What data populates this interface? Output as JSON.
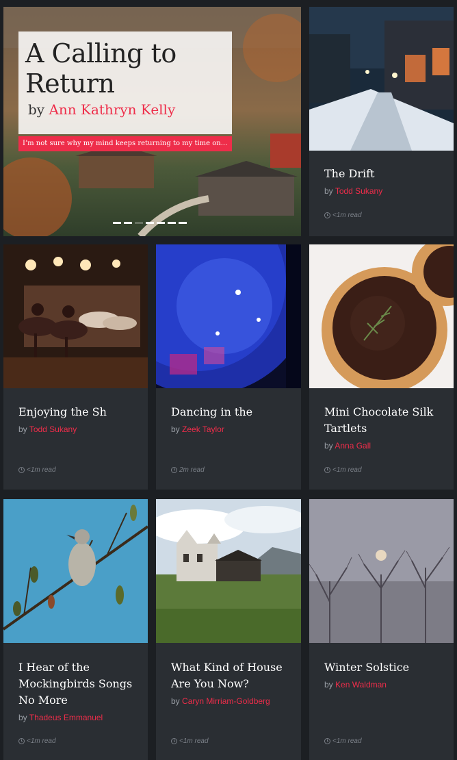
{
  "hero": {
    "title": "A Calling to Return",
    "by": "by",
    "author": "Ann Kathryn Kelly",
    "excerpt": "I’m not sure why my mind keeps returning to my time on..."
  },
  "cards": [
    {
      "title": "The Drift",
      "by": "by",
      "author": "Todd Sukany",
      "read": "<1m read",
      "image": "snowy-street-night"
    },
    {
      "title": "Enjoying the Sh",
      "by": "by",
      "author": "Todd Sukany",
      "read": "<1m read",
      "image": "ballet-dancers"
    },
    {
      "title": "Dancing in the",
      "by": "by",
      "author": "Zeek Taylor",
      "read": "2m read",
      "image": "disco-ball"
    },
    {
      "title": "Mini Chocolate Silk Tartlets",
      "by": "by",
      "author": "Anna Gall",
      "read": "<1m read",
      "image": "chocolate-tart"
    },
    {
      "title": "I Hear of the Mockingbirds Songs No More",
      "by": "by",
      "author": "Thadeus Emmanuel",
      "read": "<1m read",
      "image": "mockingbird"
    },
    {
      "title": "What Kind of House Are You Now?",
      "by": "by",
      "author": "Caryn Mirriam-Goldberg",
      "read": "<1m read",
      "image": "ruined-house"
    },
    {
      "title": "Winter Solstice",
      "by": "by",
      "author": "Ken Waldman",
      "read": "<1m read",
      "image": "winter-moon-trees"
    }
  ]
}
